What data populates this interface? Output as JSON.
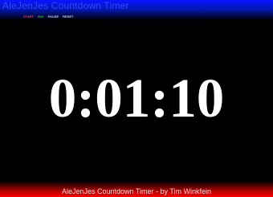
{
  "app": {
    "title": "AleJenJes Countdown Timer"
  },
  "controls": {
    "start": "START",
    "go": "GO!",
    "pause": "PAUSE",
    "reset": "RESET"
  },
  "timer": {
    "display": "0:01:10"
  },
  "footer": {
    "text": "AleJenJes Countdown Timer - by Tim Winkfein"
  }
}
